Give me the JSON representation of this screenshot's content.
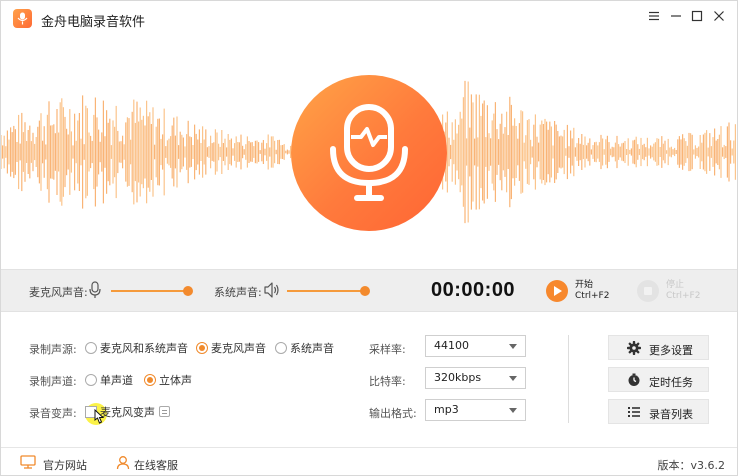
{
  "app": {
    "title": "金舟电脑录音软件",
    "accent_color": "#f7882d",
    "logo_icon": "microphone-icon"
  },
  "window_controls": {
    "menu_icon": "menu-icon",
    "minimize_icon": "minimize-icon",
    "maximize_icon": "maximize-icon",
    "close_icon": "close-icon"
  },
  "visual": {
    "center_icon": "microphone-icon"
  },
  "controls": {
    "mic_volume_label": "麦克风声音:",
    "mic_volume_level": 1.0,
    "system_volume_label": "系统声音:",
    "system_volume_level": 1.0,
    "timer": "00:00:00",
    "start_label": "开始",
    "start_shortcut": "Ctrl+F2",
    "stop_label": "停止",
    "stop_shortcut": "Ctrl+F2"
  },
  "settings": {
    "source": {
      "label": "录制声源:",
      "options": [
        "麦克风和系统声音",
        "麦克风声音",
        "系统声音"
      ],
      "selected": "麦克风声音"
    },
    "channel": {
      "label": "录制声道:",
      "options": [
        "单声道",
        "立体声"
      ],
      "selected": "立体声"
    },
    "voice_change": {
      "label": "录音变声:",
      "option": "麦克风变声",
      "checked": false
    },
    "sample_rate": {
      "label": "采样率:",
      "value": "44100"
    },
    "bit_rate": {
      "label": "比特率:",
      "value": "320kbps"
    },
    "output_format": {
      "label": "输出格式:",
      "value": "mp3"
    }
  },
  "side_buttons": {
    "more_settings": "更多设置",
    "scheduled_task": "定时任务",
    "recording_list": "录音列表"
  },
  "footer": {
    "official_site": "官方网站",
    "online_support": "在线客服",
    "version": "版本：v3.6.2"
  }
}
